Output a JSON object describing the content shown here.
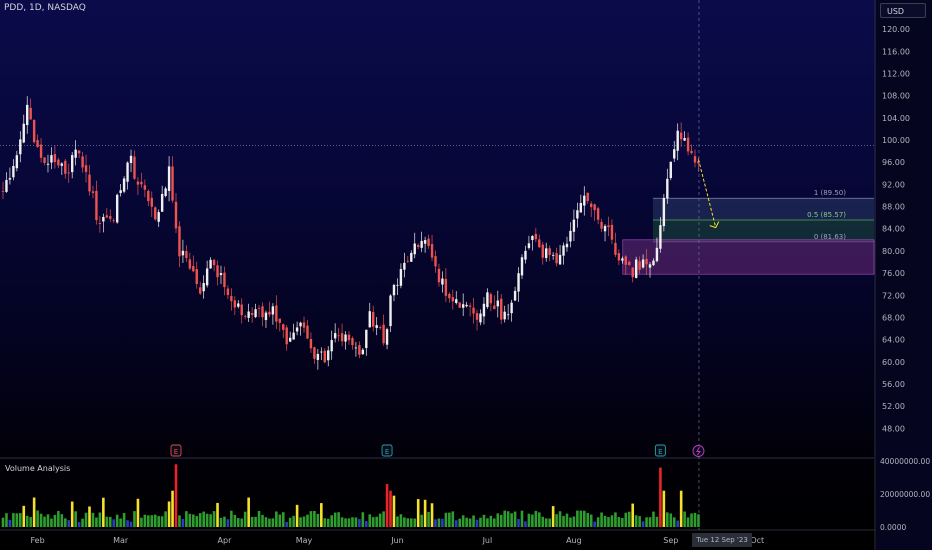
{
  "symbol_label": "PDD, 1D, NASDAQ",
  "currency": "USD",
  "volume_title": "Volume Analysis",
  "cursor_date": "Tue 12 Sep '23",
  "colors": {
    "up_candle": "#f0f0f0",
    "down_candle": "#ef5350",
    "vol_normal": "#2e9e2e",
    "vol_high": "#f5e02a",
    "vol_extreme": "#e8242a",
    "vol_low": "#2b3cc8",
    "fib_zone_top": "#3a4a6a",
    "fib_zone_bottom": "#2a4a3a",
    "demand_zone": "#7a2a8a",
    "projection": "#f5e02a",
    "earnings_badge_red": "#e74c3c",
    "earnings_badge_green": "#26a69a",
    "lightning_badge": "#c040c0"
  },
  "earnings_badges": [
    {
      "label": "E",
      "date_index": 50,
      "color": "red"
    },
    {
      "label": "E",
      "date_index": 111,
      "color": "green"
    },
    {
      "label": "E",
      "date_index": 190,
      "color": "green"
    }
  ],
  "event_badge": {
    "icon": "lightning-icon",
    "date_index": 201
  },
  "chart_data": {
    "type": "candlestick",
    "yrange": [
      45,
      122
    ],
    "ytick_labels": [
      "120.00",
      "116.00",
      "112.00",
      "108.00",
      "104.00",
      "100.00",
      "96.00",
      "92.00",
      "88.00",
      "84.00",
      "80.00",
      "76.00",
      "72.00",
      "68.00",
      "64.00",
      "60.00",
      "56.00",
      "52.00",
      "48.00"
    ],
    "yticks": [
      120,
      116,
      112,
      108,
      104,
      100,
      96,
      92,
      88,
      84,
      80,
      76,
      72,
      68,
      64,
      60,
      56,
      52,
      48
    ],
    "month_labels": [
      {
        "label": "Feb",
        "index": 10
      },
      {
        "label": "Mar",
        "index": 34
      },
      {
        "label": "Apr",
        "index": 64
      },
      {
        "label": "May",
        "index": 87
      },
      {
        "label": "Jun",
        "index": 114
      },
      {
        "label": "Jul",
        "index": 140
      },
      {
        "label": "Aug",
        "index": 165
      },
      {
        "label": "Sep",
        "index": 193
      },
      {
        "label": "Oct",
        "index": 218
      }
    ],
    "close_reference_line": 99.0,
    "fib_levels": [
      {
        "label": "1 (89.50)",
        "value": 89.5
      },
      {
        "label": "0.5 (85.57)",
        "value": 85.57
      },
      {
        "label": "0 (81.63)",
        "value": 81.63
      }
    ],
    "demand_zone": {
      "top": 82.0,
      "bottom": 75.8,
      "start_index": 180
    },
    "fib_zone_start_index": 189,
    "projection": {
      "from_index": 201,
      "from_price": 96.5,
      "to_index": 206,
      "to_price": 84.2
    },
    "volume_axis": {
      "labels": [
        "40000000.00",
        "20000000.00",
        "0.0000"
      ],
      "values": [
        40000000,
        20000000,
        0
      ]
    },
    "anchors": [
      [
        0,
        90.5
      ],
      [
        3,
        94.5
      ],
      [
        7,
        106
      ],
      [
        10,
        98
      ],
      [
        14,
        96
      ],
      [
        18,
        94
      ],
      [
        22,
        98
      ],
      [
        24,
        93
      ],
      [
        28,
        85
      ],
      [
        32,
        86
      ],
      [
        36,
        97
      ],
      [
        40,
        92
      ],
      [
        44,
        85
      ],
      [
        48,
        95
      ],
      [
        51,
        80
      ],
      [
        54,
        77
      ],
      [
        57,
        72
      ],
      [
        60,
        78
      ],
      [
        63,
        75
      ],
      [
        66,
        72
      ],
      [
        70,
        68
      ],
      [
        74,
        69
      ],
      [
        78,
        70
      ],
      [
        82,
        64
      ],
      [
        86,
        68
      ],
      [
        90,
        62
      ],
      [
        93,
        60
      ],
      [
        96,
        66
      ],
      [
        100,
        63
      ],
      [
        103,
        61
      ],
      [
        106,
        68
      ],
      [
        110,
        64
      ],
      [
        113,
        74
      ],
      [
        117,
        78
      ],
      [
        121,
        82
      ],
      [
        125,
        77
      ],
      [
        129,
        71
      ],
      [
        133,
        70
      ],
      [
        137,
        69
      ],
      [
        140,
        72
      ],
      [
        145,
        68
      ],
      [
        149,
        76
      ],
      [
        153,
        82
      ],
      [
        157,
        79
      ],
      [
        161,
        78
      ],
      [
        165,
        85
      ],
      [
        169,
        90
      ],
      [
        172,
        86
      ],
      [
        175,
        83
      ],
      [
        178,
        78
      ],
      [
        181,
        76
      ],
      [
        185,
        78
      ],
      [
        189,
        80
      ],
      [
        192,
        94
      ],
      [
        195,
        101
      ],
      [
        198,
        99
      ],
      [
        201,
        96
      ]
    ],
    "n_candles": 202
  }
}
